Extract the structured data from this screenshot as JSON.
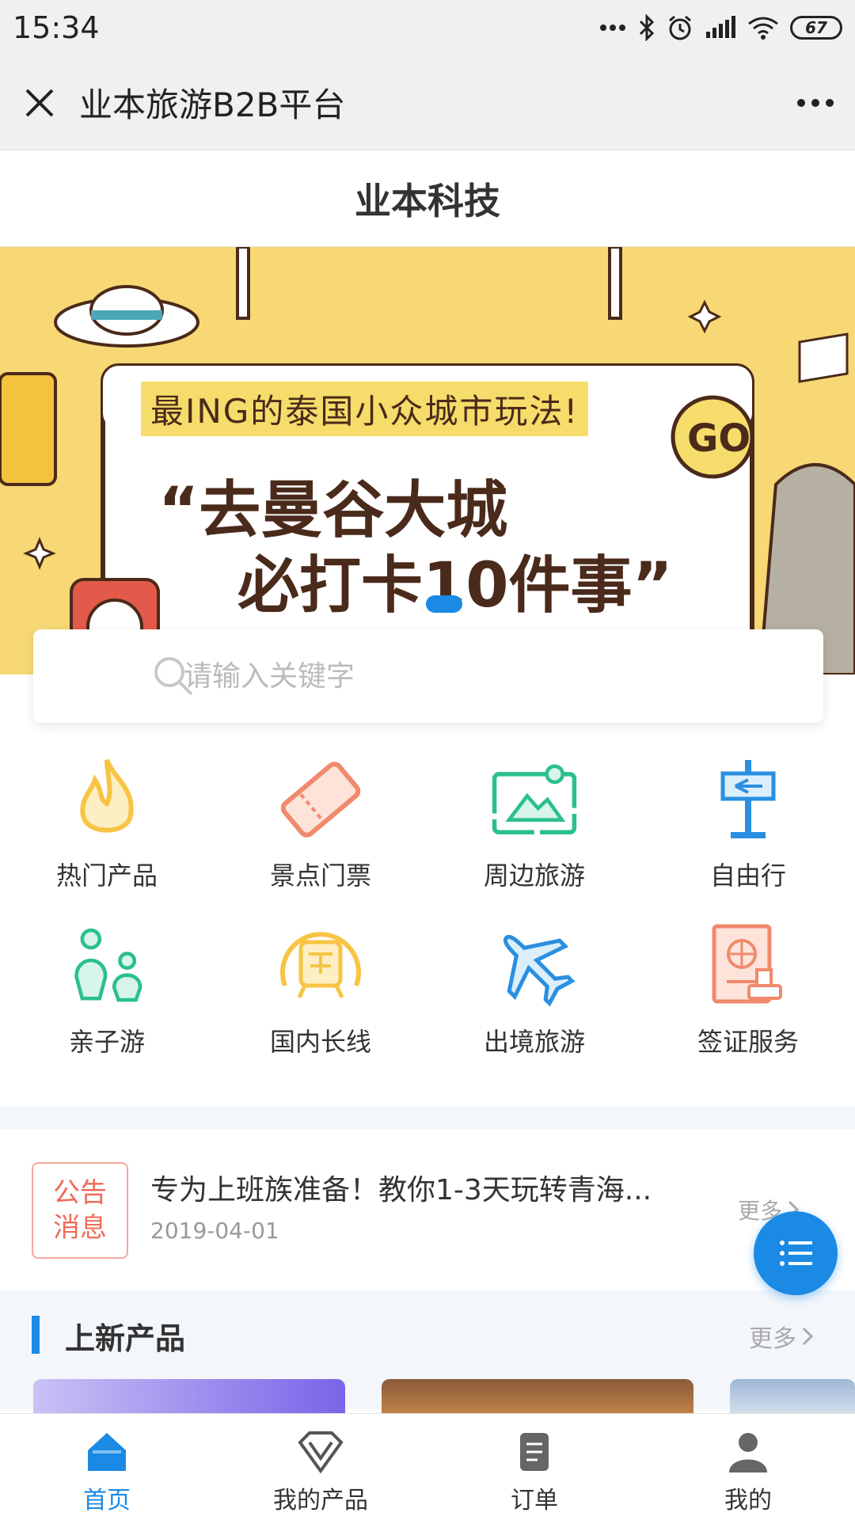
{
  "status": {
    "time": "15:34",
    "battery": "67"
  },
  "window": {
    "title": "业本旅游B2B平台"
  },
  "header": {
    "title": "业本科技"
  },
  "banner": {
    "tag": "最ING的泰国小众城市玩法!",
    "line1": "“去曼谷大城",
    "line2": "必打卡10件事”",
    "sign": "GO"
  },
  "search": {
    "placeholder": "请输入关键字"
  },
  "categories": [
    {
      "label": "热门产品",
      "icon": "fire-icon",
      "color": "#f7c443"
    },
    {
      "label": "景点门票",
      "icon": "ticket-icon",
      "color": "#f08a6c"
    },
    {
      "label": "周边旅游",
      "icon": "landscape-icon",
      "color": "#2bbf8f"
    },
    {
      "label": "自由行",
      "icon": "signpost-icon",
      "color": "#2a8fe0"
    },
    {
      "label": "亲子游",
      "icon": "family-icon",
      "color": "#2bbf8f"
    },
    {
      "label": "国内长线",
      "icon": "train-icon",
      "color": "#f7c443"
    },
    {
      "label": "出境旅游",
      "icon": "airplane-icon",
      "color": "#2a8fe0"
    },
    {
      "label": "签证服务",
      "icon": "passport-icon",
      "color": "#f08a6c"
    }
  ],
  "notice": {
    "badge_line1": "公告",
    "badge_line2": "消息",
    "text": "专为上班族准备！教你1-3天玩转青海...",
    "date": "2019-04-01",
    "more": "更多"
  },
  "new_products": {
    "title": "上新产品",
    "more": "更多"
  },
  "tabs": [
    {
      "label": "首页",
      "icon": "home-icon",
      "active": true
    },
    {
      "label": "我的产品",
      "icon": "diamond-icon",
      "active": false
    },
    {
      "label": "订单",
      "icon": "order-icon",
      "active": false
    },
    {
      "label": "我的",
      "icon": "user-icon",
      "active": false
    }
  ],
  "colors": {
    "accent": "#1a8ae5",
    "notice_red": "#ef6b58",
    "banner_bg": "#f7d875"
  }
}
